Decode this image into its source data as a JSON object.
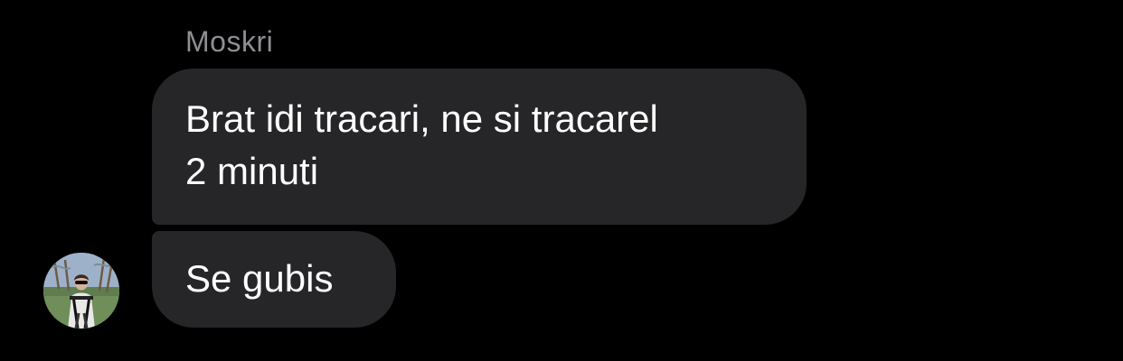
{
  "thread": {
    "sender_name": "Moskri",
    "messages": [
      {
        "lines": [
          "Brat idi tracari, ne si tracarel",
          "2 minuti"
        ]
      },
      {
        "lines": [
          "Se gubis"
        ]
      }
    ],
    "avatar_icon": "user-photo-avatar"
  },
  "colors": {
    "background": "#000000",
    "bubble": "#262628",
    "message_text": "#ffffff",
    "sender_name": "#8e8e93"
  }
}
